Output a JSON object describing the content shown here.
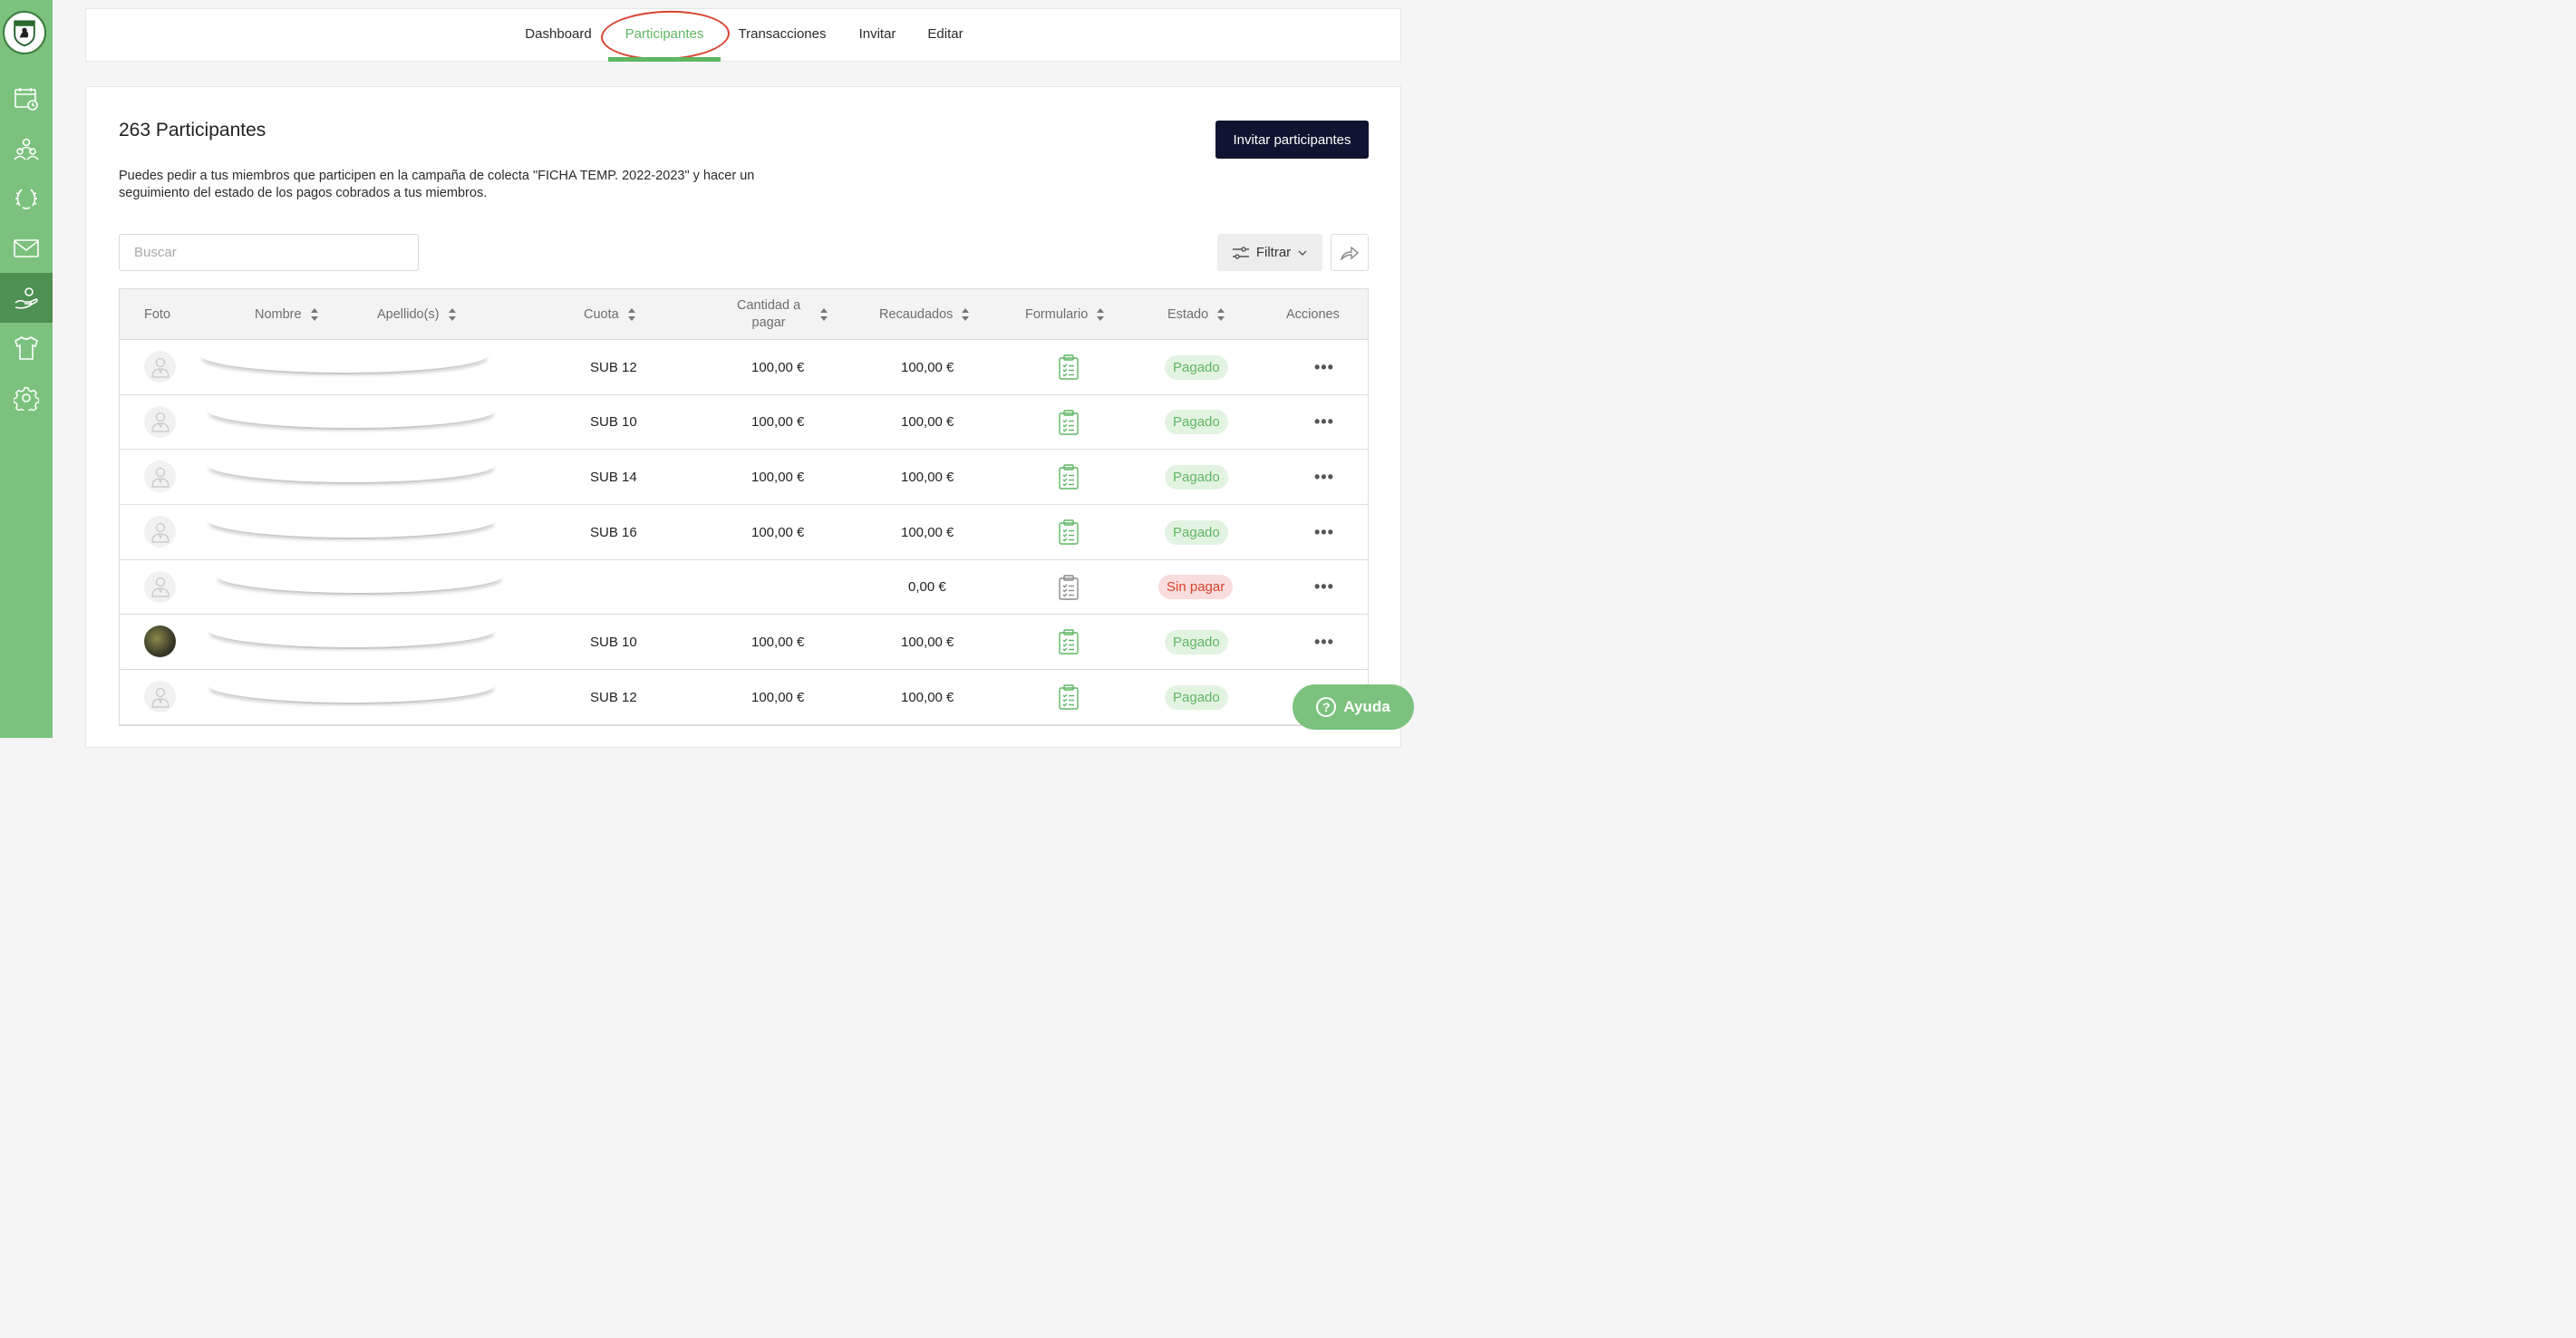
{
  "sidebar": {
    "logo_icon": "club-crest-icon",
    "items": [
      {
        "icon": "calendar-icon"
      },
      {
        "icon": "members-icon"
      },
      {
        "icon": "laurel-icon"
      },
      {
        "icon": "mail-icon"
      },
      {
        "icon": "hand-donation-icon",
        "active": true
      },
      {
        "icon": "tshirt-icon"
      },
      {
        "icon": "gear-icon"
      }
    ]
  },
  "tabs": [
    {
      "label": "Dashboard"
    },
    {
      "label": "Participantes",
      "active": true
    },
    {
      "label": "Transacciones"
    },
    {
      "label": "Invitar"
    },
    {
      "label": "Editar"
    }
  ],
  "main": {
    "title": "263 Participantes",
    "invite_button": "Invitar participantes",
    "description": "Puedes pedir a tus miembros que participen en la campaña de colecta \"FICHA TEMP. 2022-2023\" y hacer un seguimiento del estado de los pagos cobrados a tus miembros.",
    "search_placeholder": "Buscar",
    "filter_label": "Filtrar"
  },
  "table": {
    "headers": {
      "foto": "Foto",
      "nombre": "Nombre",
      "apellido": "Apellido(s)",
      "cuota": "Cuota",
      "cantidad_line1": "Cantidad a",
      "cantidad_line2": "pagar",
      "recaudados": "Recaudados",
      "formulario": "Formulario",
      "estado": "Estado",
      "acciones": "Acciones"
    },
    "rows": [
      {
        "cuota": "SUB 12",
        "cantidad": "100,00 €",
        "recaudados": "100,00 €",
        "estado": "Pagado",
        "paid": true,
        "photo": false
      },
      {
        "cuota": "SUB 10",
        "cantidad": "100,00 €",
        "recaudados": "100,00 €",
        "estado": "Pagado",
        "paid": true,
        "photo": false
      },
      {
        "cuota": "SUB 14",
        "cantidad": "100,00 €",
        "recaudados": "100,00 €",
        "estado": "Pagado",
        "paid": true,
        "photo": false
      },
      {
        "cuota": "SUB 16",
        "cantidad": "100,00 €",
        "recaudados": "100,00 €",
        "estado": "Pagado",
        "paid": true,
        "photo": false
      },
      {
        "cuota": "",
        "cantidad": "",
        "recaudados": "0,00 €",
        "estado": "Sin pagar",
        "paid": false,
        "photo": false
      },
      {
        "cuota": "SUB 10",
        "cantidad": "100,00 €",
        "recaudados": "100,00 €",
        "estado": "Pagado",
        "paid": true,
        "photo": true
      },
      {
        "cuota": "SUB 12",
        "cantidad": "100,00 €",
        "recaudados": "100,00 €",
        "estado": "Pagado",
        "paid": true,
        "photo": false
      }
    ],
    "actions_glyph": "•••"
  },
  "help_button": "Ayuda",
  "colors": {
    "sidebar": "#7cc27e",
    "sidebar_active": "#4e8f52",
    "accent": "#5fb663",
    "primary_button": "#0f1530",
    "unpaid": "#d9432f"
  }
}
